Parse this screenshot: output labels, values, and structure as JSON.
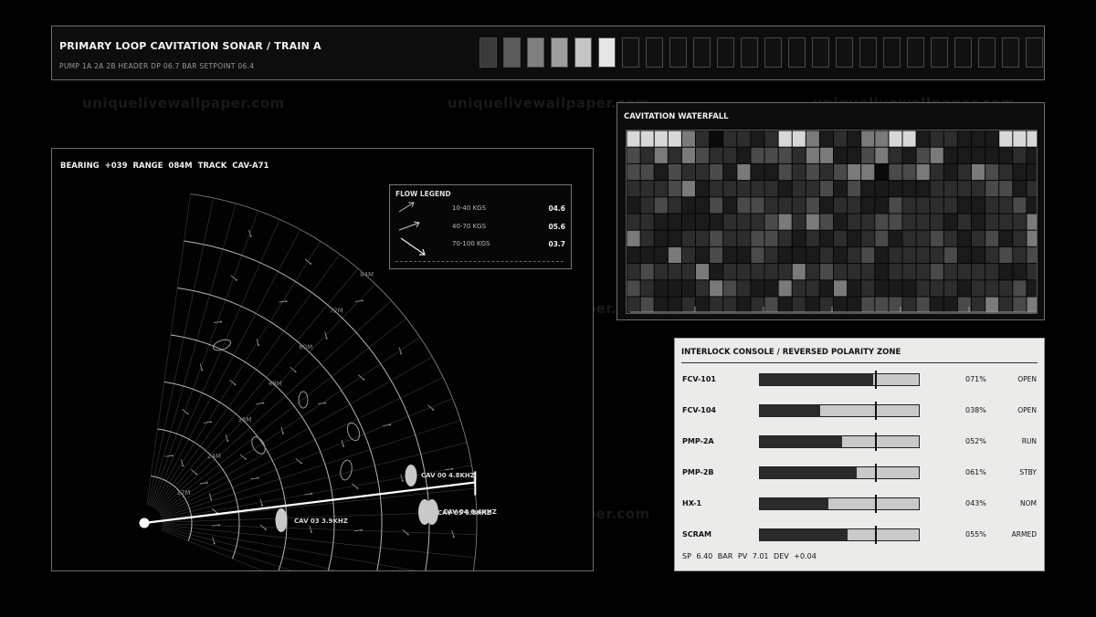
{
  "header": {
    "title": "PRIMARY LOOP CAVITATION SONAR / TRAIN A",
    "subtitle": "PUMP 1A 2A 2B   HEADER DP 06.7 BAR   SETPOINT 06.4",
    "level_strip": [
      "#3a3a3a",
      "#5c5c5c",
      "#808080",
      "#9e9e9e",
      "#c4c4c4",
      "#e6e6e6",
      "#111111",
      "#111111",
      "#111111",
      "#111111",
      "#111111",
      "#111111",
      "#111111",
      "#111111",
      "#111111",
      "#111111",
      "#111111",
      "#111111",
      "#111111",
      "#111111",
      "#111111",
      "#111111",
      "#111111",
      "#111111"
    ]
  },
  "watermark": "uniquelivewallpaper.com",
  "sonar": {
    "status": "BEARING +039   RANGE 084M   TRACK CAV-A71",
    "range_rings": [
      "12M",
      "24M",
      "36M",
      "48M",
      "60M",
      "72M",
      "84M"
    ],
    "targets": [
      {
        "label": "CAV 00  4.8KHZ"
      },
      {
        "label": "CAV 03  3.9KHZ"
      },
      {
        "label": "CAV 04  6.4KHZ"
      },
      {
        "label": "CAV 05  6.8KHZ"
      }
    ]
  },
  "legend": {
    "title": "FLOW LEGEND",
    "rows": [
      {
        "label": "10-40 KGS",
        "value": "04.6"
      },
      {
        "label": "40-70 KGS",
        "value": "05.6"
      },
      {
        "label": "70-100 KGS",
        "value": "03.7"
      }
    ]
  },
  "waterfall": {
    "title": "CAVITATION WATERFALL",
    "rows": [
      "9999420221299412144991221119999411112002",
      "3242432213332441134213411111211223314211",
      "3313223141132323440334212432112321423141",
      "2223412222212231311111222233121411121224",
      "1232113133222312211322221122314241121342",
      "2211111222342431223322212122244112212142",
      "4211223223321212123122321231241122421141",
      "1114213113211121231222231123232332212311",
      "2322241222224232221222322221123221212212",
      "3211124321142214121112221222312141322321",
      "2311212212312121133323113242342134221113"
    ]
  },
  "console": {
    "title": "INTERLOCK CONSOLE / REVERSED POLARITY ZONE",
    "rows": [
      {
        "tag": "FCV-101",
        "pct": "071%",
        "level": 0.71,
        "state": "OPEN"
      },
      {
        "tag": "FCV-104",
        "pct": "038%",
        "level": 0.38,
        "state": "OPEN"
      },
      {
        "tag": "PMP-2A",
        "pct": "052%",
        "level": 0.52,
        "state": "RUN"
      },
      {
        "tag": "PMP-2B",
        "pct": "061%",
        "level": 0.61,
        "state": "STBY"
      },
      {
        "tag": "HX-1",
        "pct": "043%",
        "level": 0.43,
        "state": "NOM"
      },
      {
        "tag": "SCRAM",
        "pct": "055%",
        "level": 0.55,
        "state": "ARMED"
      }
    ],
    "footer": "SP 6.40 BAR   PV 7.01   DEV +0.04"
  }
}
